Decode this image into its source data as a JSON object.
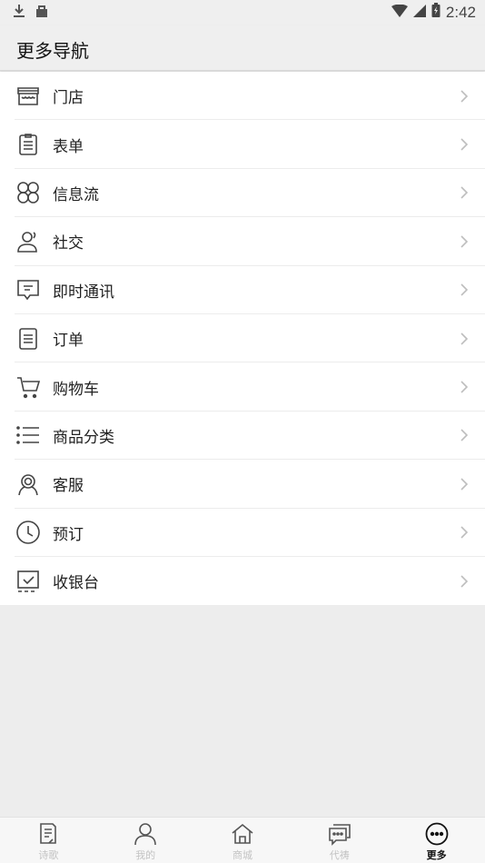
{
  "status_bar": {
    "time": "2:42",
    "icons": [
      "download-icon",
      "bag-icon",
      "wifi-icon",
      "cell-signal-icon",
      "battery-icon"
    ]
  },
  "header": {
    "title": "更多导航"
  },
  "menu": {
    "items": [
      {
        "label": "门店",
        "icon": "store-icon"
      },
      {
        "label": "表单",
        "icon": "clipboard-icon"
      },
      {
        "label": "信息流",
        "icon": "feed-icon"
      },
      {
        "label": "社交",
        "icon": "social-icon"
      },
      {
        "label": "即时通讯",
        "icon": "chat-icon"
      },
      {
        "label": "订单",
        "icon": "order-icon"
      },
      {
        "label": "购物车",
        "icon": "cart-icon"
      },
      {
        "label": "商品分类",
        "icon": "category-list-icon"
      },
      {
        "label": "客服",
        "icon": "support-icon"
      },
      {
        "label": "预订",
        "icon": "clock-icon"
      },
      {
        "label": "收银台",
        "icon": "checkout-icon"
      }
    ]
  },
  "tabbar": {
    "tabs": [
      {
        "label": "诗歌",
        "icon": "document-icon",
        "active": false
      },
      {
        "label": "我的",
        "icon": "user-icon",
        "active": false
      },
      {
        "label": "商城",
        "icon": "home-icon",
        "active": false
      },
      {
        "label": "代祷",
        "icon": "message-icon",
        "active": false
      },
      {
        "label": "更多",
        "icon": "more-icon",
        "active": true
      }
    ]
  },
  "colors": {
    "background": "#ededed",
    "header_bg": "#efefef",
    "list_bg": "#ffffff",
    "icon_stroke": "#444444",
    "chevron": "#bdbdbd",
    "tab_inactive": "#c3c3c3",
    "tab_active": "#111111"
  }
}
